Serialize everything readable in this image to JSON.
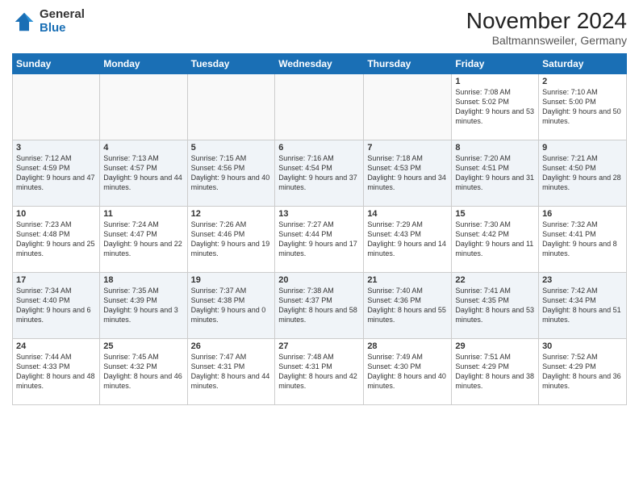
{
  "header": {
    "logo_general": "General",
    "logo_blue": "Blue",
    "month_title": "November 2024",
    "location": "Baltmannsweiler, Germany"
  },
  "weekdays": [
    "Sunday",
    "Monday",
    "Tuesday",
    "Wednesday",
    "Thursday",
    "Friday",
    "Saturday"
  ],
  "weeks": [
    [
      {
        "day": "",
        "text": ""
      },
      {
        "day": "",
        "text": ""
      },
      {
        "day": "",
        "text": ""
      },
      {
        "day": "",
        "text": ""
      },
      {
        "day": "",
        "text": ""
      },
      {
        "day": "1",
        "text": "Sunrise: 7:08 AM\nSunset: 5:02 PM\nDaylight: 9 hours and 53 minutes."
      },
      {
        "day": "2",
        "text": "Sunrise: 7:10 AM\nSunset: 5:00 PM\nDaylight: 9 hours and 50 minutes."
      }
    ],
    [
      {
        "day": "3",
        "text": "Sunrise: 7:12 AM\nSunset: 4:59 PM\nDaylight: 9 hours and 47 minutes."
      },
      {
        "day": "4",
        "text": "Sunrise: 7:13 AM\nSunset: 4:57 PM\nDaylight: 9 hours and 44 minutes."
      },
      {
        "day": "5",
        "text": "Sunrise: 7:15 AM\nSunset: 4:56 PM\nDaylight: 9 hours and 40 minutes."
      },
      {
        "day": "6",
        "text": "Sunrise: 7:16 AM\nSunset: 4:54 PM\nDaylight: 9 hours and 37 minutes."
      },
      {
        "day": "7",
        "text": "Sunrise: 7:18 AM\nSunset: 4:53 PM\nDaylight: 9 hours and 34 minutes."
      },
      {
        "day": "8",
        "text": "Sunrise: 7:20 AM\nSunset: 4:51 PM\nDaylight: 9 hours and 31 minutes."
      },
      {
        "day": "9",
        "text": "Sunrise: 7:21 AM\nSunset: 4:50 PM\nDaylight: 9 hours and 28 minutes."
      }
    ],
    [
      {
        "day": "10",
        "text": "Sunrise: 7:23 AM\nSunset: 4:48 PM\nDaylight: 9 hours and 25 minutes."
      },
      {
        "day": "11",
        "text": "Sunrise: 7:24 AM\nSunset: 4:47 PM\nDaylight: 9 hours and 22 minutes."
      },
      {
        "day": "12",
        "text": "Sunrise: 7:26 AM\nSunset: 4:46 PM\nDaylight: 9 hours and 19 minutes."
      },
      {
        "day": "13",
        "text": "Sunrise: 7:27 AM\nSunset: 4:44 PM\nDaylight: 9 hours and 17 minutes."
      },
      {
        "day": "14",
        "text": "Sunrise: 7:29 AM\nSunset: 4:43 PM\nDaylight: 9 hours and 14 minutes."
      },
      {
        "day": "15",
        "text": "Sunrise: 7:30 AM\nSunset: 4:42 PM\nDaylight: 9 hours and 11 minutes."
      },
      {
        "day": "16",
        "text": "Sunrise: 7:32 AM\nSunset: 4:41 PM\nDaylight: 9 hours and 8 minutes."
      }
    ],
    [
      {
        "day": "17",
        "text": "Sunrise: 7:34 AM\nSunset: 4:40 PM\nDaylight: 9 hours and 6 minutes."
      },
      {
        "day": "18",
        "text": "Sunrise: 7:35 AM\nSunset: 4:39 PM\nDaylight: 9 hours and 3 minutes."
      },
      {
        "day": "19",
        "text": "Sunrise: 7:37 AM\nSunset: 4:38 PM\nDaylight: 9 hours and 0 minutes."
      },
      {
        "day": "20",
        "text": "Sunrise: 7:38 AM\nSunset: 4:37 PM\nDaylight: 8 hours and 58 minutes."
      },
      {
        "day": "21",
        "text": "Sunrise: 7:40 AM\nSunset: 4:36 PM\nDaylight: 8 hours and 55 minutes."
      },
      {
        "day": "22",
        "text": "Sunrise: 7:41 AM\nSunset: 4:35 PM\nDaylight: 8 hours and 53 minutes."
      },
      {
        "day": "23",
        "text": "Sunrise: 7:42 AM\nSunset: 4:34 PM\nDaylight: 8 hours and 51 minutes."
      }
    ],
    [
      {
        "day": "24",
        "text": "Sunrise: 7:44 AM\nSunset: 4:33 PM\nDaylight: 8 hours and 48 minutes."
      },
      {
        "day": "25",
        "text": "Sunrise: 7:45 AM\nSunset: 4:32 PM\nDaylight: 8 hours and 46 minutes."
      },
      {
        "day": "26",
        "text": "Sunrise: 7:47 AM\nSunset: 4:31 PM\nDaylight: 8 hours and 44 minutes."
      },
      {
        "day": "27",
        "text": "Sunrise: 7:48 AM\nSunset: 4:31 PM\nDaylight: 8 hours and 42 minutes."
      },
      {
        "day": "28",
        "text": "Sunrise: 7:49 AM\nSunset: 4:30 PM\nDaylight: 8 hours and 40 minutes."
      },
      {
        "day": "29",
        "text": "Sunrise: 7:51 AM\nSunset: 4:29 PM\nDaylight: 8 hours and 38 minutes."
      },
      {
        "day": "30",
        "text": "Sunrise: 7:52 AM\nSunset: 4:29 PM\nDaylight: 8 hours and 36 minutes."
      }
    ]
  ]
}
